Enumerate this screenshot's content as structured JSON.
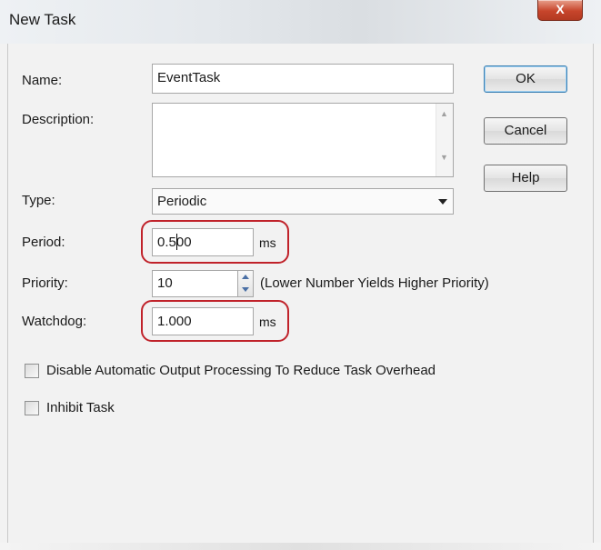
{
  "window": {
    "title": "New Task",
    "close_glyph": "X"
  },
  "form": {
    "name_label": "Name:",
    "name_value": "EventTask",
    "description_label": "Description:",
    "description_value": "",
    "type_label": "Type:",
    "type_value": "Periodic",
    "period_label": "Period:",
    "period_value": "0.500",
    "period_unit": "ms",
    "priority_label": "Priority:",
    "priority_value": "10",
    "priority_hint": "(Lower Number Yields Higher Priority)",
    "watchdog_label": "Watchdog:",
    "watchdog_value": "1.000",
    "watchdog_unit": "ms"
  },
  "buttons": {
    "ok": "OK",
    "cancel": "Cancel",
    "help": "Help"
  },
  "options": [
    {
      "label": "Disable Automatic Output Processing To Reduce Task Overhead",
      "checked": false
    },
    {
      "label": "Inhibit Task",
      "checked": false
    }
  ],
  "colors": {
    "highlight": "#c0222a",
    "close_button": "#c7452b"
  },
  "icons": {
    "close": "close-icon",
    "scroll_up": "scroll-up-arrow-icon",
    "scroll_down": "scroll-down-arrow-icon",
    "dropdown": "chevron-down-icon",
    "spin_up": "spin-up-icon",
    "spin_down": "spin-down-icon"
  }
}
